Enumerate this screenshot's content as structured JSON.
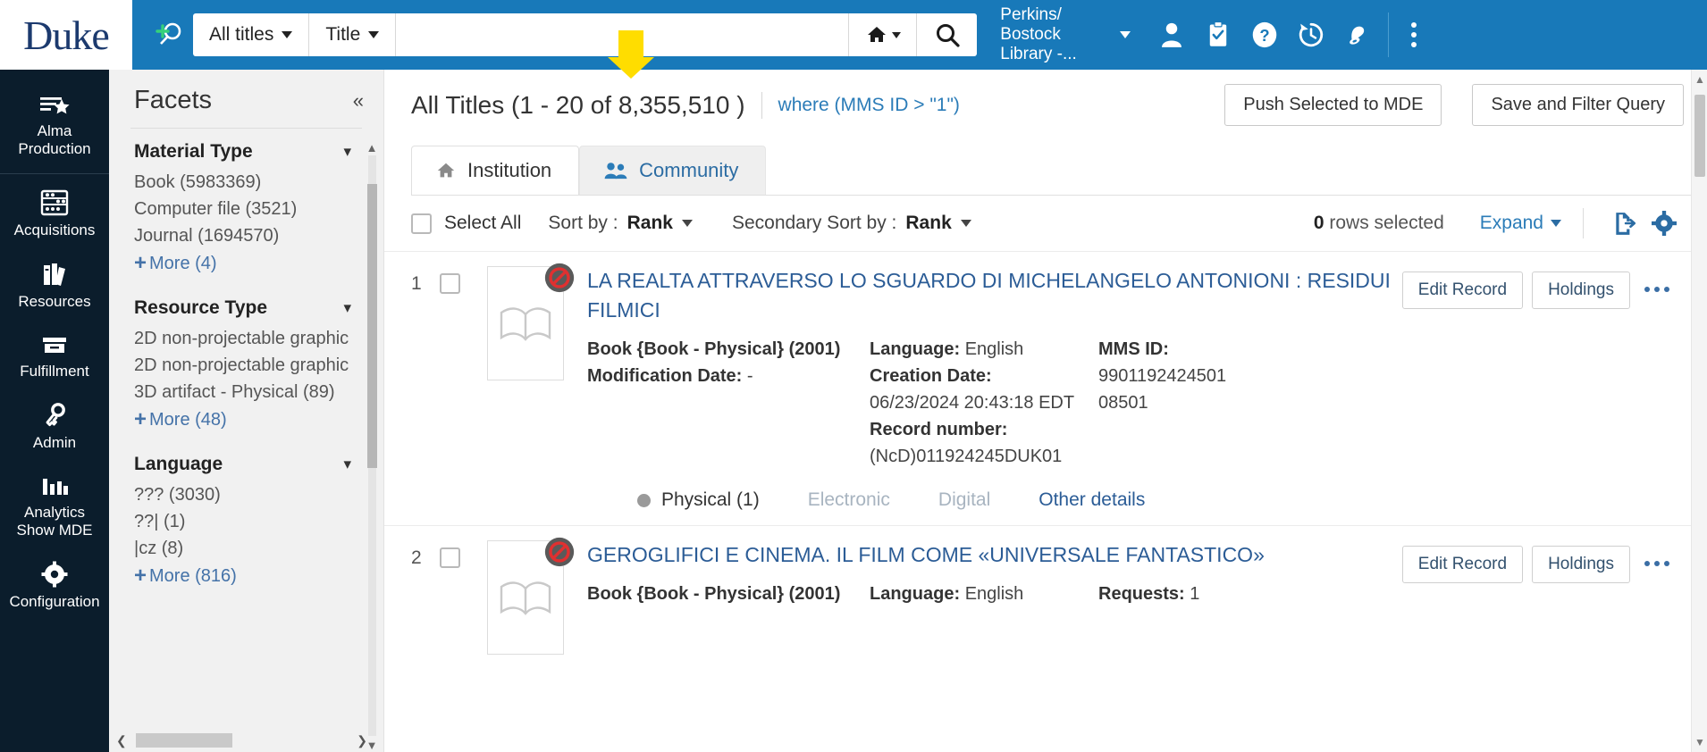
{
  "brand": {
    "name": "Duke"
  },
  "search": {
    "scope_label": "All titles",
    "field_label": "Title",
    "query_value": "",
    "placeholder": "",
    "new_search_icon": "new-search-icon",
    "home_icon": "home-icon",
    "search_icon": "search-icon"
  },
  "header": {
    "institution": "Perkins/ Bostock Library -...",
    "institution_line1": "Perkins/",
    "institution_line2": "Bostock",
    "institution_line3": "Library -...",
    "icons": [
      "user-icon",
      "tasks-icon",
      "help-icon",
      "history-icon",
      "alerts-bell-icon",
      "more-menu-icon"
    ],
    "accent_color": "#1879b9"
  },
  "sidebar": {
    "items": [
      {
        "label": "Alma Production",
        "icon": "alma-production-icon"
      },
      {
        "label": "Acquisitions",
        "icon": "acquisitions-icon"
      },
      {
        "label": "Resources",
        "icon": "resources-icon"
      },
      {
        "label": "Fulfillment",
        "icon": "fulfillment-icon"
      },
      {
        "label": "Admin",
        "icon": "admin-key-icon"
      },
      {
        "label": "Analytics",
        "label2": "Show MDE",
        "icon": "analytics-icon"
      },
      {
        "label": "Configuration",
        "icon": "configuration-gear-icon"
      }
    ]
  },
  "facets": {
    "title": "Facets",
    "collapse_icon": "collapse-left-icon",
    "groups": [
      {
        "name": "Material Type",
        "values": [
          "Book (5983369)",
          "Computer file (3521)",
          "Journal (1694570)"
        ],
        "more": "More (4)"
      },
      {
        "name": "Resource Type",
        "values": [
          "2D non-projectable graphic",
          "2D non-projectable graphic",
          "3D artifact - Physical (89)"
        ],
        "more": "More (48)"
      },
      {
        "name": "Language",
        "values": [
          "??? (3030)",
          "??| (1)",
          "|cz (8)"
        ],
        "more": "More (816)"
      }
    ]
  },
  "results": {
    "title": "All Titles (1 - 20 of 8,355,510 )",
    "where_clause": "where (MMS ID > \"1\")",
    "push_button": "Push Selected to MDE",
    "save_button": "Save and Filter Query"
  },
  "tabs": [
    {
      "label": "Institution",
      "icon": "home-icon",
      "active": true
    },
    {
      "label": "Community",
      "icon": "community-people-icon",
      "active": false
    }
  ],
  "toolbar": {
    "select_all": "Select All",
    "sort_by_label": "Sort by :",
    "sort_by_value": "Rank",
    "secondary_sort_label": "Secondary Sort by :",
    "secondary_sort_value": "Rank",
    "rows_selected_count": "0",
    "rows_selected_text": "rows selected",
    "expand_label": "Expand",
    "export_icon": "export-icon",
    "settings_icon": "gear-icon"
  },
  "records": [
    {
      "number": "1",
      "title": "LA REALTA ATTRAVERSO LO SGUARDO DI MICHELANGELO ANTONIONI : RESIDUI FILMICI",
      "format": "Book {Book - Physical} (2001)",
      "modification_date_label": "Modification Date:",
      "modification_date": "-",
      "language_label": "Language:",
      "language": "English",
      "creation_date_label": "Creation Date:",
      "creation_date": "06/23/2024 20:43:18 EDT",
      "record_number_label": "Record number:",
      "record_number": "(NcD)011924245DUK01",
      "mms_id_label": "MMS ID:",
      "mms_id": "990119242450108501",
      "availability": [
        {
          "label": "Physical (1)",
          "state": "on"
        },
        {
          "label": "Electronic",
          "state": "off"
        },
        {
          "label": "Digital",
          "state": "off"
        },
        {
          "label": "Other details",
          "state": "link"
        }
      ],
      "actions": [
        "Edit Record",
        "Holdings"
      ],
      "more_icon": "row-more-icon",
      "suppressed_icon": "suppressed-from-discovery-icon"
    },
    {
      "number": "2",
      "title": "GEROGLIFICI E CINEMA. IL FILM COME «UNIVERSALE FANTASTICO»",
      "format": "Book {Book - Physical} (2001)",
      "language_label": "Language:",
      "language": "English",
      "requests_label": "Requests:",
      "requests": "1",
      "actions": [
        "Edit Record",
        "Holdings"
      ],
      "more_icon": "row-more-icon",
      "suppressed_icon": "suppressed-from-discovery-icon"
    }
  ],
  "cursor": {
    "icon": "down-arrow-cursor",
    "color": "#ffdd00"
  }
}
